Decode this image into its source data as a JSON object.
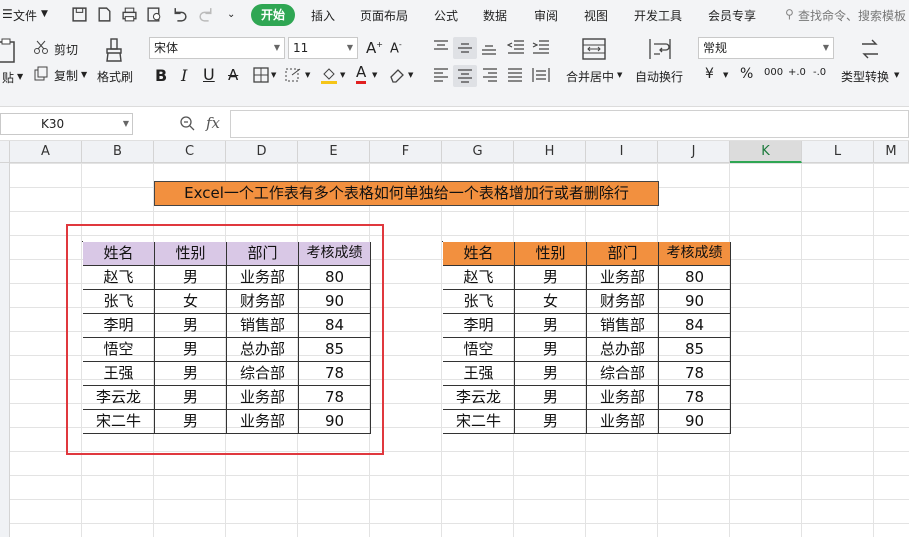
{
  "menu": {
    "file": "文件",
    "start": "开始",
    "tabs": [
      "插入",
      "页面布局",
      "公式",
      "数据",
      "审阅",
      "视图",
      "开发工具",
      "会员专享"
    ],
    "search": "查找命令、搜索模板"
  },
  "ribbon": {
    "cut": "剪切",
    "paste": "贴",
    "copy": "复制",
    "format_painter": "格式刷",
    "font": "宋体",
    "size": "11",
    "merge": "合并居中",
    "wrap": "自动换行",
    "number_format": "常规",
    "type_convert": "类型转换",
    "currency": "¥",
    "percent": "%",
    "thousands": "000",
    "dec_inc": "+.0",
    "dec_dec": "-.0"
  },
  "formula": {
    "cell_ref": "K30",
    "fx": "fx"
  },
  "columns": [
    "A",
    "B",
    "C",
    "D",
    "E",
    "F",
    "G",
    "H",
    "I",
    "J",
    "K",
    "L",
    "M"
  ],
  "selected_column": "K",
  "sheet": {
    "title": "Excel一个工作表有多个表格如何单独给一个表格增加行或者删除行",
    "headers": [
      "姓名",
      "性别",
      "部门",
      "考核成绩"
    ],
    "rows": [
      [
        "赵飞",
        "男",
        "业务部",
        "80"
      ],
      [
        "张飞",
        "女",
        "财务部",
        "90"
      ],
      [
        "李明",
        "男",
        "销售部",
        "84"
      ],
      [
        "悟空",
        "男",
        "总办部",
        "85"
      ],
      [
        "王强",
        "男",
        "综合部",
        "78"
      ],
      [
        "李云龙",
        "男",
        "业务部",
        "78"
      ],
      [
        "宋二牛",
        "男",
        "业务部",
        "90"
      ]
    ],
    "header_color_left": "#d9c8e6",
    "header_color_right": "#f2903f",
    "title_color": "#f2903f",
    "highlight_color": "#e0383e"
  }
}
